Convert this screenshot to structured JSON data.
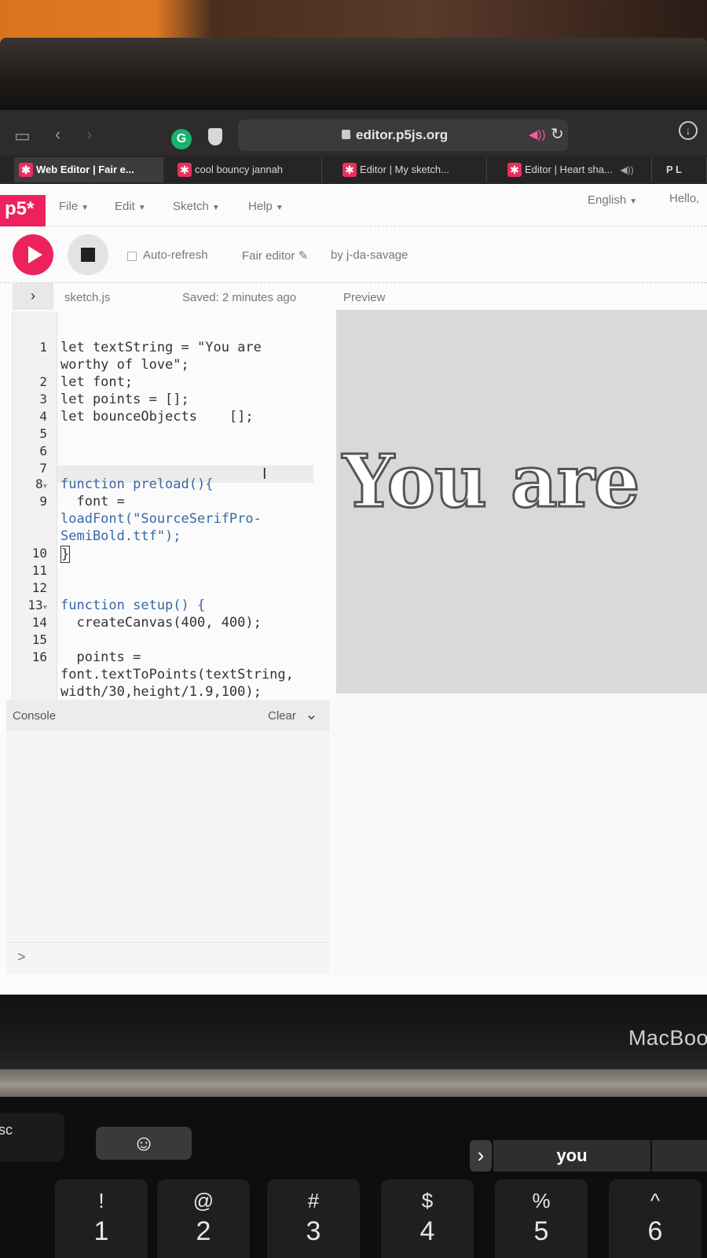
{
  "browser": {
    "url": "editor.p5js.org",
    "tabs": [
      {
        "title": "Web Editor | Fair e...",
        "active": true
      },
      {
        "title": "cool bouncy jannah",
        "active": false
      },
      {
        "title": "Editor | My sketch...",
        "active": false
      },
      {
        "title": "Editor | Heart sha...",
        "active": false
      },
      {
        "title": "P L",
        "active": false
      }
    ]
  },
  "p5": {
    "logo": "p5*",
    "menu": {
      "file": "File",
      "edit": "Edit",
      "sketch": "Sketch",
      "help": "Help",
      "language": "English",
      "greeting": "Hello,"
    },
    "controls": {
      "auto_refresh": "Auto-refresh",
      "sketch_name": "Fair editor",
      "author": "by j-da-savage"
    },
    "file": {
      "name": "sketch.js",
      "saved": "Saved: 2 minutes ago",
      "preview_label": "Preview"
    },
    "code": {
      "line1a": "let textString = \"You are",
      "line1b": "worthy of love\";",
      "line2": "let font;",
      "line3": "let points = [];",
      "line4": "let bounceObjects    [];",
      "line8": "function preload(){",
      "line9a": "  font =",
      "line9b": "loadFont(\"SourceSerifPro-",
      "line9c": "SemiBold.ttf\");",
      "line10": "}",
      "line13": "function setup() {",
      "line14": "  createCanvas(400, 400);",
      "line16a": "  points =",
      "line16b": "font.textToPoints(textString,",
      "line16c": "width/30,height/1.9,100);"
    },
    "preview_text": "You are",
    "console": {
      "label": "Console",
      "clear": "Clear",
      "prompt": ">"
    }
  },
  "hardware": {
    "brand": "MacBoo",
    "touchbar_suggestion": "you",
    "esc": "sc",
    "keys": [
      {
        "sym": "!",
        "num": "1"
      },
      {
        "sym": "@",
        "num": "2"
      },
      {
        "sym": "#",
        "num": "3"
      },
      {
        "sym": "$",
        "num": "4"
      },
      {
        "sym": "%",
        "num": "5"
      },
      {
        "sym": "^",
        "num": "6"
      }
    ]
  }
}
